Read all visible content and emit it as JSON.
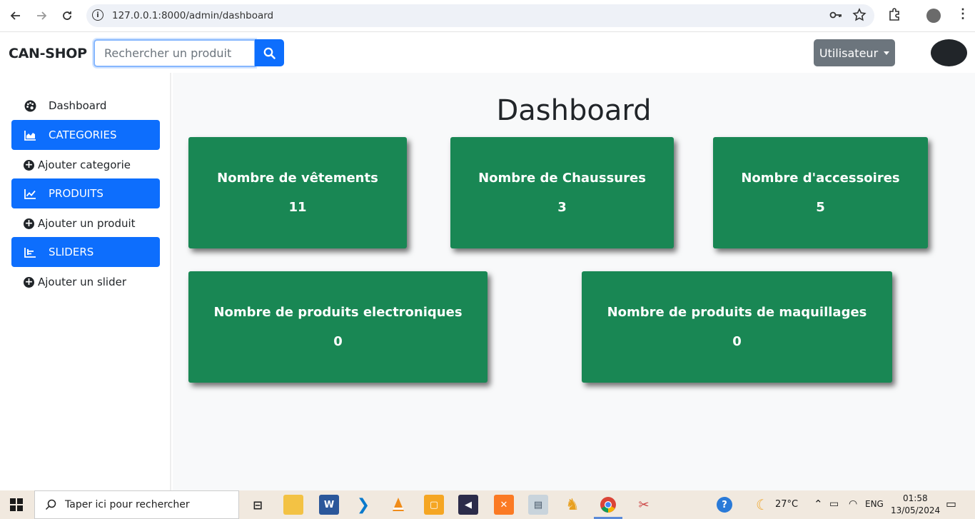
{
  "browser": {
    "url": "127.0.0.1:8000/admin/dashboard"
  },
  "navbar": {
    "brand": "CAN-SHOP",
    "search_placeholder": "Rechercher un produit",
    "user_button": "Utilisateur"
  },
  "sidebar": {
    "items": [
      {
        "label": "Dashboard",
        "icon": "palette-icon",
        "active": false
      },
      {
        "label": "CATEGORIES",
        "icon": "area-chart-icon",
        "active": true
      },
      {
        "label": "Ajouter categorie",
        "icon": "plus-circle-icon",
        "type": "add"
      },
      {
        "label": "PRODUITS",
        "icon": "line-chart-icon",
        "active": true
      },
      {
        "label": "Ajouter un produit",
        "icon": "plus-circle-icon",
        "type": "add"
      },
      {
        "label": "SLIDERS",
        "icon": "bar-chart-icon",
        "active": true
      },
      {
        "label": "Ajouter un slider",
        "icon": "plus-circle-icon",
        "type": "add"
      }
    ]
  },
  "main": {
    "title": "Dashboard",
    "cards": [
      {
        "title": "Nombre de vêtements",
        "value": "11"
      },
      {
        "title": "Nombre de Chaussures",
        "value": "3"
      },
      {
        "title": "Nombre d'accessoires",
        "value": "5"
      },
      {
        "title": "Nombre de produits electroniques",
        "value": "0"
      },
      {
        "title": "Nombre de produits de maquillages",
        "value": "0"
      }
    ],
    "card_color": "#198754"
  },
  "taskbar": {
    "search_text": "Taper ici pour rechercher",
    "weather": "27°C",
    "language": "ENG",
    "time": "01:58",
    "date": "13/05/2024"
  },
  "colors": {
    "primary": "#0d6efd",
    "secondary": "#6c757d",
    "success": "#198754"
  }
}
